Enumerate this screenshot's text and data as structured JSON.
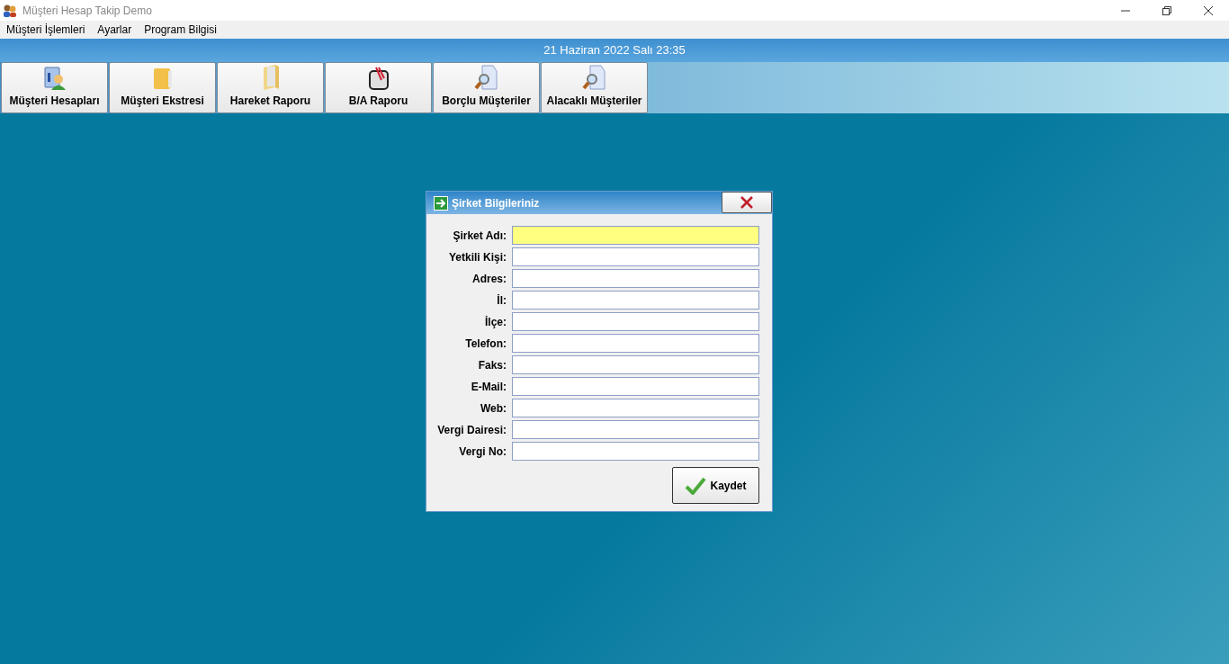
{
  "window": {
    "title": "Müşteri Hesap Takip Demo"
  },
  "menu": [
    "Müşteri İşlemleri",
    "Ayarlar",
    "Program Bilgisi"
  ],
  "date_bar": "21 Haziran 2022 Salı 23:35",
  "toolbar": [
    {
      "label": "Müşteri Hesapları",
      "kind": "card"
    },
    {
      "label": "Müşteri Ekstresi",
      "kind": "folder"
    },
    {
      "label": "Hareket Raporu",
      "kind": "open-folder"
    },
    {
      "label": "B/A Raporu",
      "kind": "clip"
    },
    {
      "label": "Borçlu Müşteriler",
      "kind": "search"
    },
    {
      "label": "Alacaklı Müşteriler",
      "kind": "search"
    }
  ],
  "dialog": {
    "title": "Şirket Bilgileriniz",
    "fields": [
      {
        "label": "Şirket Adı:",
        "focused": true
      },
      {
        "label": "Yetkili Kişi:",
        "focused": false
      },
      {
        "label": "Adres:",
        "focused": false
      },
      {
        "label": "İl:",
        "focused": false
      },
      {
        "label": "İlçe:",
        "focused": false
      },
      {
        "label": "Telefon:",
        "focused": false
      },
      {
        "label": "Faks:",
        "focused": false
      },
      {
        "label": "E-Mail:",
        "focused": false
      },
      {
        "label": "Web:",
        "focused": false
      },
      {
        "label": "Vergi Dairesi:",
        "focused": false
      },
      {
        "label": "Vergi No:",
        "focused": false
      }
    ],
    "save_button": "Kaydet"
  }
}
